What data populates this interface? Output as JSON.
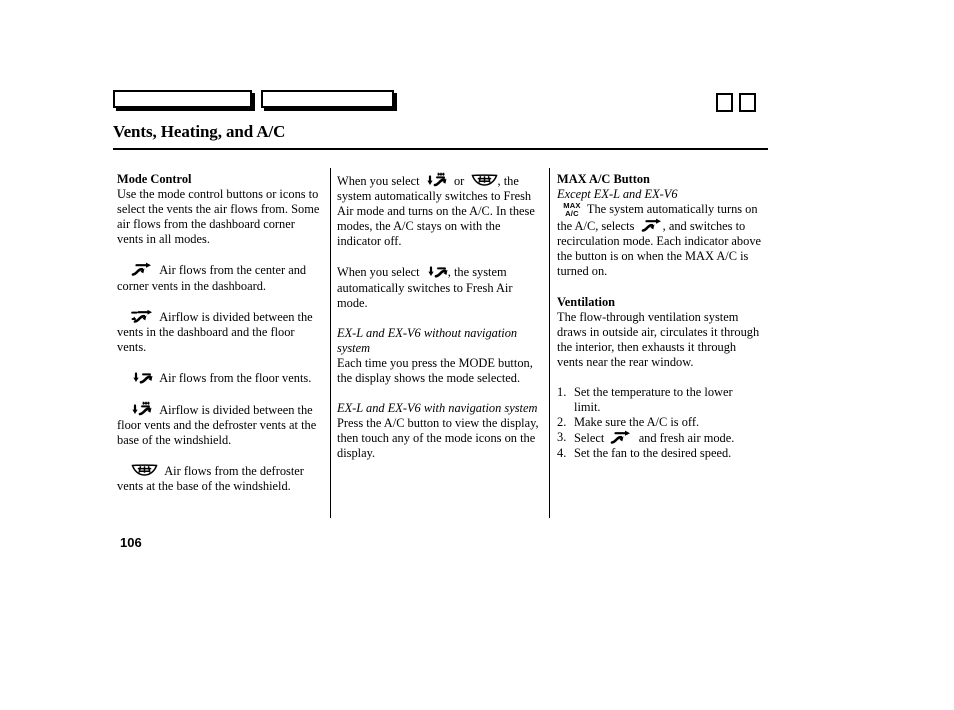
{
  "header": {
    "title": "Vents, Heating, and A/C",
    "tabs": [
      {
        "label": "",
        "name": "section-tab-1"
      },
      {
        "label": "",
        "name": "section-tab-2"
      }
    ],
    "corner_marks": [
      "",
      ""
    ]
  },
  "columns": {
    "left": {
      "heading": "Mode Control",
      "intro": "Use the mode control buttons or icons to select the vents the air flows from. Some air flows from the dashboard corner vents in all modes.",
      "modes": [
        {
          "icon": "vent-dashboard-icon",
          "text": "Air flows from the center and corner vents in the dashboard."
        },
        {
          "icon": "vent-dashboard-floor-icon",
          "text": "Airflow is divided between the vents in the dashboard and the floor vents."
        },
        {
          "icon": "vent-floor-icon",
          "text": "Air flows from the floor vents."
        },
        {
          "icon": "vent-floor-defroster-icon",
          "text": "Airflow is divided between the floor vents and the defroster vents at the base of the windshield."
        },
        {
          "icon": "vent-defroster-icon",
          "text": "Air flows from the defroster vents at the base of the windshield."
        }
      ]
    },
    "middle": {
      "p1_a": "When you select",
      "p1_icon1": "vent-floor-defroster-icon",
      "p1_or": "or",
      "p1_icon2": "vent-defroster-icon",
      "p1_b": ", the system automatically switches to Fresh Air mode and turns on the A/C. In these modes, the A/C stays on with the indicator off.",
      "p2_a": "When you select",
      "p2_icon": "vent-floor-icon",
      "p2_b": ", the system automatically switches to Fresh Air mode.",
      "sub1": "EX-L and EX-V6 without navigation system",
      "sub1_body": "Each time you press the MODE button, the display shows the mode selected.",
      "sub2": "EX-L and EX-V6 with navigation system",
      "sub2_body": "Press the A/C button to view the display, then touch any of the mode icons on the display."
    },
    "right": {
      "heading1": "MAX A/C Button",
      "subhead1": "Except EX-L and EX-V6",
      "maxac_icon_line1": "MAX",
      "maxac_icon_line2": "A/C",
      "p1_a": "The system automatically turns on the A/C, selects",
      "p1_icon": "vent-dashboard-icon",
      "p1_b": ", and switches to recirculation mode. Each indicator above the button is on when the MAX A/C is turned on.",
      "heading2": "Ventilation",
      "p2": "The flow-through ventilation system draws in outside air, circulates it through the interior, then exhausts it through vents near the rear window.",
      "steps": [
        {
          "num": "1.",
          "text": "Set the temperature to the lower limit."
        },
        {
          "num": "2.",
          "text": "Make sure the A/C is off."
        },
        {
          "num": "3.",
          "pre": "Select",
          "icon": "vent-dashboard-icon",
          "post": "and fresh air mode."
        },
        {
          "num": "4.",
          "text": "Set the fan to the desired speed."
        }
      ]
    }
  },
  "footer": {
    "page_number": "106"
  },
  "colors": {
    "ink": "#000000",
    "paper": "#ffffff"
  }
}
